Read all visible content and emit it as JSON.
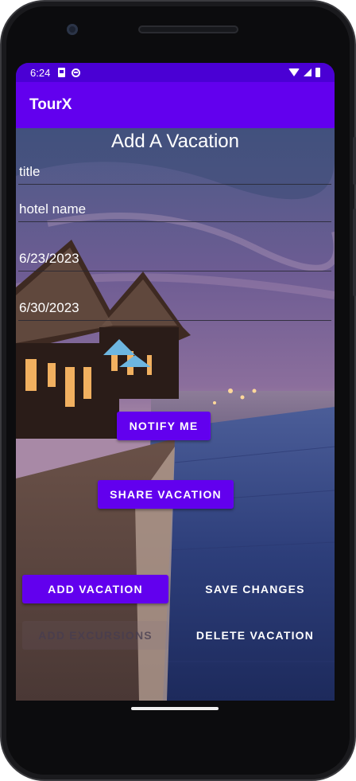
{
  "status_bar": {
    "time": "6:24",
    "background_color": "#4a00d4",
    "icons": [
      "sim-icon",
      "data-saver-icon",
      "wifi-icon",
      "signal-icon",
      "battery-icon"
    ]
  },
  "app_bar": {
    "title": "TourX",
    "background_color": "#6200ee"
  },
  "form": {
    "page_title": "Add A Vacation",
    "title_field": "title",
    "hotel_field": "hotel name",
    "start_date": "6/23/2023",
    "end_date": "6/30/2023"
  },
  "buttons": {
    "notify": "NOTIFY ME",
    "share": "SHARE VACATION",
    "add_vacation": "ADD VACATION",
    "save_changes": "SAVE CHANGES",
    "add_excursions": "ADD EXCURSIONS",
    "delete_vacation": "DELETE VACATION"
  },
  "colors": {
    "accent": "#6200ee",
    "text_on_accent": "#ffffff"
  }
}
